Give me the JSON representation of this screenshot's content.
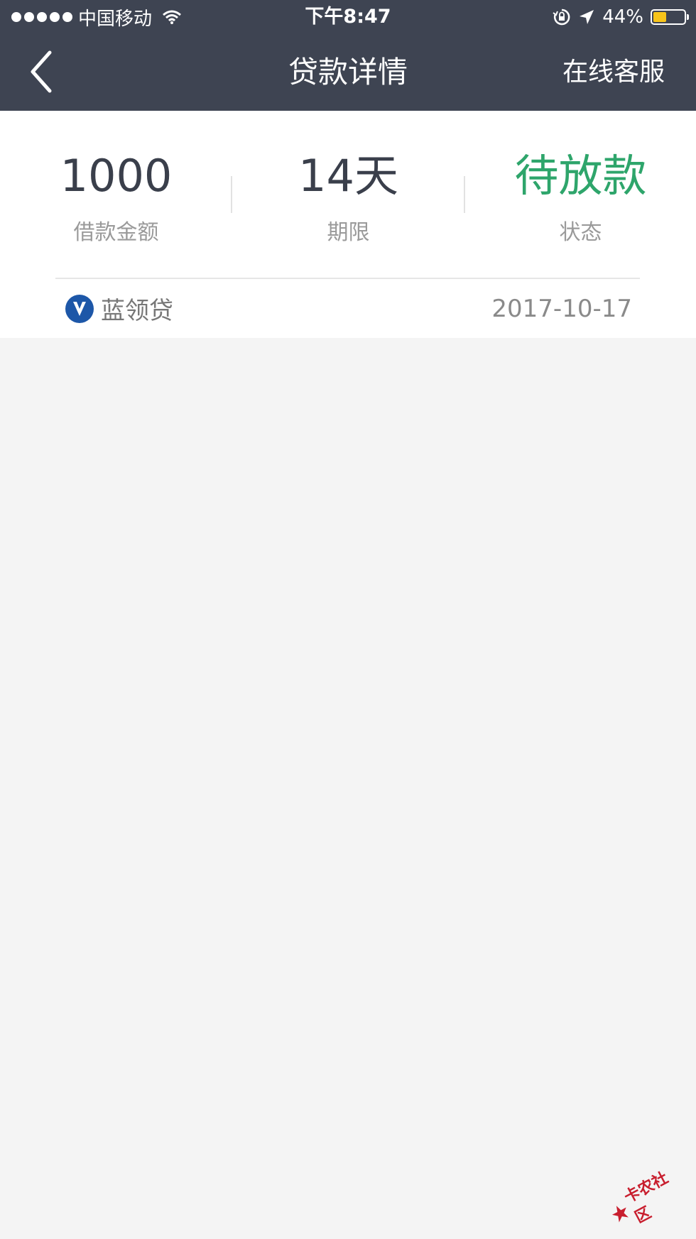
{
  "status_bar": {
    "carrier": "中国移动",
    "time": "下午8:47",
    "battery_percent": "44%",
    "battery_level": 0.44,
    "signal_dots": 5
  },
  "nav": {
    "title": "贷款详情",
    "action": "在线客服"
  },
  "summary": {
    "amount": {
      "value": "1000",
      "label": "借款金额"
    },
    "term": {
      "value": "14天",
      "label": "期限"
    },
    "status": {
      "value": "待放款",
      "label": "状态",
      "color": "#2ea56b"
    }
  },
  "lender": {
    "name": "蓝领贷",
    "date": "2017-10-17",
    "logo_color": "#1d57a8"
  },
  "watermark": {
    "text": "卡农社区"
  }
}
